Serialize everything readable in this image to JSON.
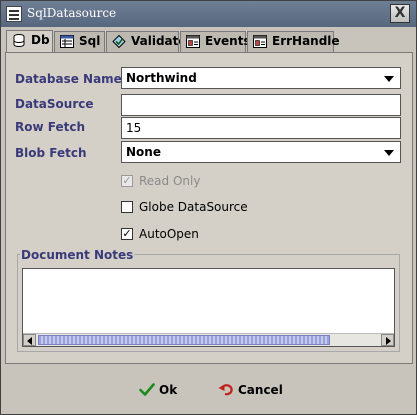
{
  "window": {
    "title": "SqlDatasource",
    "close_label": "X"
  },
  "tabs": [
    {
      "label": "Db",
      "icon": "database-icon",
      "active": true
    },
    {
      "label": "Sql",
      "icon": "sql-icon",
      "active": false
    },
    {
      "label": "Validate",
      "icon": "validate-icon",
      "active": false
    },
    {
      "label": "Events",
      "icon": "events-icon",
      "active": false
    },
    {
      "label": "ErrHandle",
      "icon": "error-handle-icon",
      "active": false
    }
  ],
  "form": {
    "database_name": {
      "label": "Database Name",
      "value": "Northwind"
    },
    "datasource": {
      "label": "DataSource",
      "value": ""
    },
    "row_fetch": {
      "label": "Row Fetch",
      "value": "15"
    },
    "blob_fetch": {
      "label": "Blob Fetch",
      "value": "None"
    }
  },
  "checkboxes": {
    "read_only": {
      "label": "Read Only",
      "checked": true,
      "enabled": false
    },
    "globe_datasource": {
      "label": "Globe DataSource",
      "checked": false,
      "enabled": true
    },
    "auto_open": {
      "label": "AutoOpen",
      "checked": true,
      "enabled": true
    }
  },
  "notes": {
    "legend": "Document Notes",
    "value": ""
  },
  "buttons": {
    "ok_label": "Ok",
    "cancel_label": "Cancel"
  },
  "colors": {
    "label_color": "#3a3a7a",
    "title_bar": "#5f6f86",
    "ok_green": "#1d8a1d",
    "cancel_red": "#c0201a"
  }
}
